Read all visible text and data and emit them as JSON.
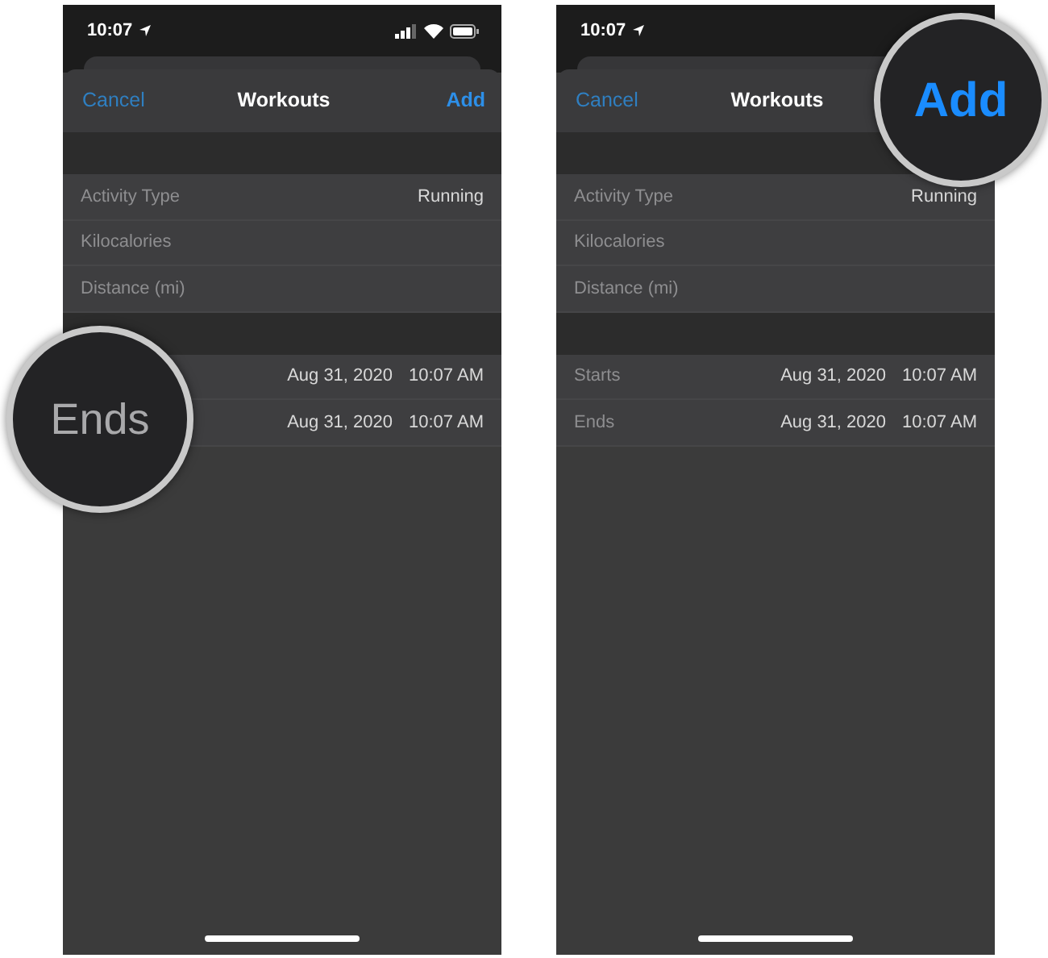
{
  "screens": [
    {
      "status_bar": {
        "time": "10:07",
        "icons_shown": true
      },
      "nav": {
        "cancel": "Cancel",
        "title": "Workouts",
        "add": "Add"
      },
      "sections": [
        [
          {
            "label": "Activity Type",
            "value": "Running"
          },
          {
            "label": "Kilocalories"
          },
          {
            "label": "Distance (mi)"
          }
        ],
        [
          {
            "date": "Aug 31, 2020",
            "time": "10:07 AM"
          },
          {
            "date": "Aug 31, 2020",
            "time": "10:07 AM"
          }
        ]
      ],
      "magnifier": {
        "text": "Ends",
        "kind": "label"
      }
    },
    {
      "status_bar": {
        "time": "10:07",
        "icons_shown": false
      },
      "nav": {
        "cancel": "Cancel",
        "title": "Workouts"
      },
      "sections": [
        [
          {
            "label": "Activity Type",
            "value": "Running"
          },
          {
            "label": "Kilocalories"
          },
          {
            "label": "Distance (mi)"
          }
        ],
        [
          {
            "label": "Starts",
            "date": "Aug 31, 2020",
            "time": "10:07 AM"
          },
          {
            "label": "Ends",
            "date": "Aug 31, 2020",
            "time": "10:07 AM"
          }
        ]
      ],
      "magnifier": {
        "text": "Add",
        "kind": "action"
      }
    }
  ]
}
